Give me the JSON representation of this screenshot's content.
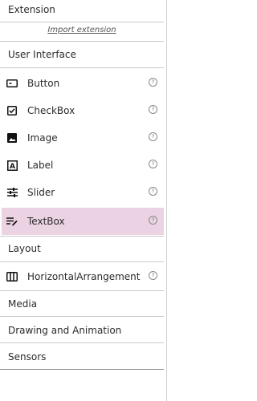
{
  "palette": {
    "header_label": "Extension",
    "import_link": "Import extension",
    "sections": {
      "user_interface": "User Interface",
      "layout": "Layout",
      "media": "Media",
      "drawing": "Drawing and Animation",
      "sensors": "Sensors"
    },
    "ui_components": [
      {
        "label": "Button",
        "icon": "button-icon"
      },
      {
        "label": "CheckBox",
        "icon": "checkbox-icon"
      },
      {
        "label": "Image",
        "icon": "image-icon"
      },
      {
        "label": "Label",
        "icon": "label-icon"
      },
      {
        "label": "Slider",
        "icon": "slider-icon"
      },
      {
        "label": "TextBox",
        "icon": "textbox-icon",
        "selected": true
      }
    ],
    "layout_components": [
      {
        "label": "HorizontalArrangement",
        "icon": "horizontal-arrangement-icon"
      }
    ],
    "help_glyph": "?",
    "colors": {
      "selected_bg": "#ecd3e4"
    }
  }
}
